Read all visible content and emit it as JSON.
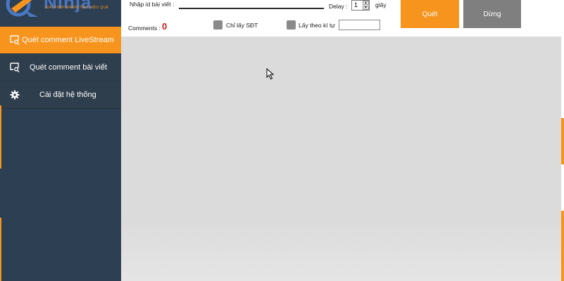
{
  "app": {
    "logo_text": "Ninja",
    "logo_tagline": "GIẢI PHÁP MARKETING HIỆU QUẢ",
    "accent_color": "#f7941d",
    "sidebar_color": "#2d3f52"
  },
  "sidebar": {
    "items": [
      {
        "label": "Quét comment LiveStream",
        "icon": "chat-search-icon",
        "active": true
      },
      {
        "label": "Quét comment bài viết",
        "icon": "chat-search-icon",
        "active": false
      },
      {
        "label": "Cài đặt hệ thống",
        "icon": "gear-icon",
        "active": false
      }
    ]
  },
  "toolbar": {
    "post_id_label": "Nhập id bài viết :",
    "post_id_value": "",
    "delay_label": "Delay :",
    "delay_value": "1",
    "delay_unit": "giây",
    "comments_label": "Comments :",
    "comments_count": "0",
    "phone_only_label": "Chỉ lấy SĐT",
    "by_char_label": "Lấy theo kí tự",
    "by_char_value": "",
    "scan_button": "Quét",
    "stop_button": "Dừng"
  }
}
